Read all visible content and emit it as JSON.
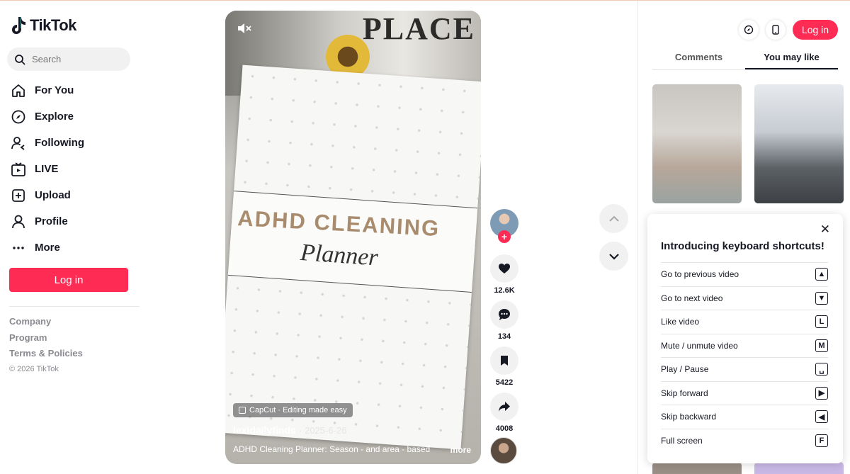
{
  "sidebar": {
    "brand": "TikTok",
    "search_placeholder": "Search",
    "nav": [
      {
        "label": "For You",
        "icon": "home-icon"
      },
      {
        "label": "Explore",
        "icon": "compass-icon"
      },
      {
        "label": "Following",
        "icon": "following-icon"
      },
      {
        "label": "LIVE",
        "icon": "live-icon"
      },
      {
        "label": "Upload",
        "icon": "upload-icon"
      },
      {
        "label": "Profile",
        "icon": "profile-icon"
      },
      {
        "label": "More",
        "icon": "more-icon"
      }
    ],
    "login_label": "Log in",
    "footer": [
      "Company",
      "Program",
      "Terms & Policies"
    ],
    "copyright": "© 2026 TikTok"
  },
  "video": {
    "image_text_top": "PLACE",
    "image_text_title": "ADHD CLEANING",
    "image_text_sub": "Planner",
    "capcut_label": "CapCut · Editing made easy",
    "author": "lexidailyfinds",
    "date": "· 2025-6-26",
    "description": "ADHD Cleaning Planner: Season - and area - based",
    "more_label": "more"
  },
  "actions": {
    "likes": "12.6K",
    "comments": "134",
    "saves": "5422",
    "shares": "4008"
  },
  "top_bar": {
    "login_label": "Log in"
  },
  "tabs": [
    "Comments",
    "You may like"
  ],
  "shortcuts": {
    "title": "Introducing keyboard shortcuts!",
    "items": [
      {
        "label": "Go to previous video",
        "key": "▲"
      },
      {
        "label": "Go to next video",
        "key": "▼"
      },
      {
        "label": "Like video",
        "key": "L"
      },
      {
        "label": "Mute / unmute video",
        "key": "M"
      },
      {
        "label": "Play / Pause",
        "key": "␣"
      },
      {
        "label": "Skip forward",
        "key": "▶"
      },
      {
        "label": "Skip backward",
        "key": "◀"
      },
      {
        "label": "Full screen",
        "key": "F"
      }
    ]
  },
  "colors": {
    "brand": "#fe2c55",
    "text": "#161823",
    "muted": "#8a8b91"
  }
}
